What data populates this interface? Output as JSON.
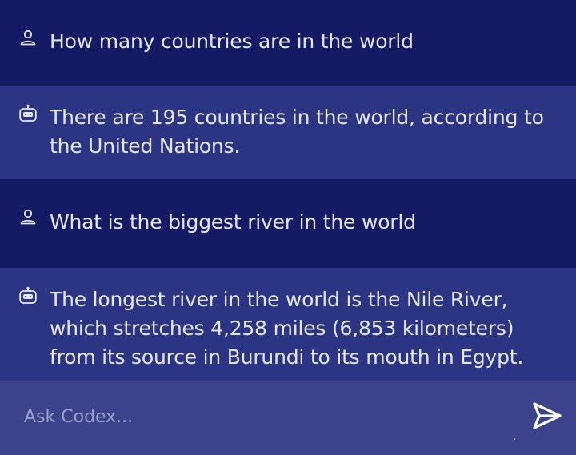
{
  "chat": {
    "messages": [
      {
        "role": "user",
        "text": "How many countries are in the world"
      },
      {
        "role": "bot",
        "text": "There are 195 countries in the world, according to the United Nations."
      },
      {
        "role": "user",
        "text": "What is the biggest river in the world"
      },
      {
        "role": "bot",
        "text": "The longest river in the world is the Nile River, which stretches 4,258 miles (6,853 kilometers) from its source in Burundi to its mouth in Egypt."
      }
    ]
  },
  "composer": {
    "placeholder": "Ask Codex...",
    "value": ""
  },
  "icons": {
    "user": "person-icon",
    "bot": "robot-icon",
    "send": "send-icon"
  },
  "colors": {
    "background": "#151a64",
    "bot_bubble": "#2c3484",
    "composer": "#3c438c",
    "text": "#e6e8f7"
  }
}
